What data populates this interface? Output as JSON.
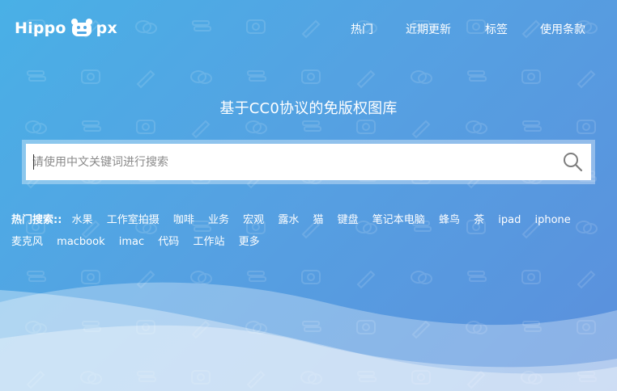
{
  "brand": {
    "name_left": "Hippo",
    "name_right": "px",
    "mascot_icon": "hippo-mascot-icon"
  },
  "nav": {
    "items": [
      {
        "label": "热门"
      },
      {
        "label": "近期更新"
      },
      {
        "label": "标签"
      },
      {
        "label": "使用条款"
      }
    ]
  },
  "hero": {
    "title": "基于CC0协议的免版权图库"
  },
  "search": {
    "placeholder": "请使用中文关键词进行搜索",
    "value": "",
    "icon": "search-icon"
  },
  "hot_search": {
    "label": "热门搜索::",
    "tags": [
      "水果",
      "工作室拍摄",
      "咖啡",
      "业务",
      "宏观",
      "露水",
      "猫",
      "键盘",
      "笔记本电脑",
      "蜂鸟",
      "茶",
      "ipad",
      "iphone",
      "麦克风",
      "macbook",
      "imac",
      "代码",
      "工作站",
      "更多"
    ]
  },
  "colors": {
    "bg_start": "#49b0e6",
    "bg_end": "#5b8fdc",
    "text": "#ffffff",
    "wave": "#ffffff"
  }
}
